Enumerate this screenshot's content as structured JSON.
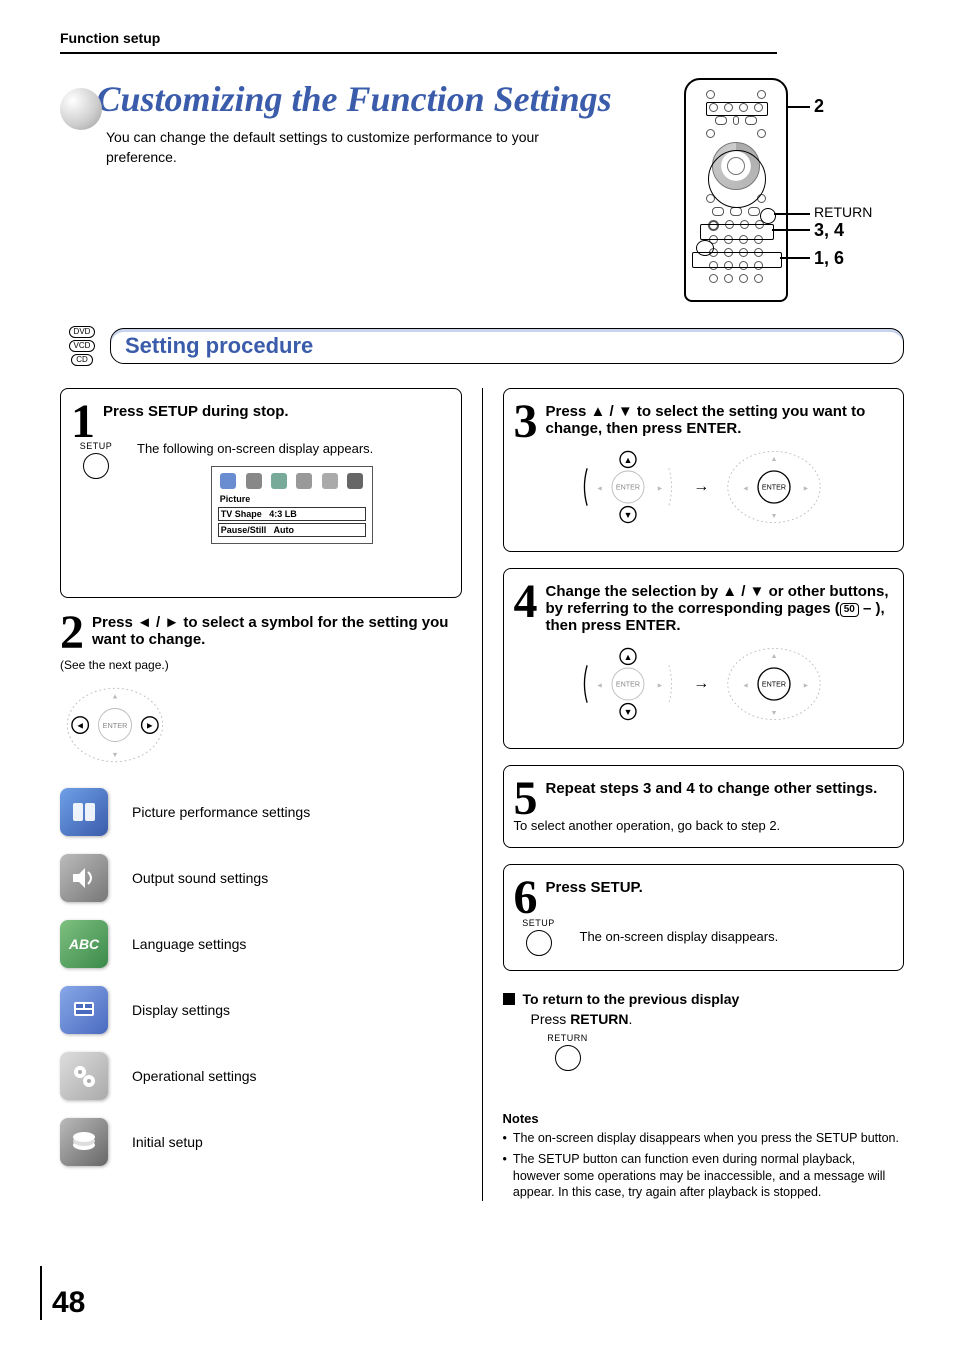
{
  "header": {
    "section": "Function setup"
  },
  "title": {
    "main": "Customizing the Function Settings",
    "sub": "You can change the default settings to customize performance to your preference."
  },
  "remote": {
    "callouts": [
      {
        "label": "2"
      },
      {
        "label": "RETURN"
      },
      {
        "label": "3, 4"
      },
      {
        "label": "1, 6"
      }
    ]
  },
  "disc_tags": [
    "DVD",
    "VCD",
    "CD"
  ],
  "procedure_title": "Setting procedure",
  "steps": {
    "s1": {
      "num": "1",
      "head": "Press SETUP during stop.",
      "setup_label": "SETUP",
      "text": "The following on-screen display appears.",
      "osd": {
        "line1": "Picture",
        "line2_left": "TV Shape",
        "line2_right": "4:3 LB",
        "line3_left": "Pause/Still",
        "line3_right": "Auto"
      }
    },
    "s2": {
      "num": "2",
      "head": "Press ◄ / ► to select a symbol for the setting you want to change.",
      "note": "(See the next page.)",
      "enter": "ENTER",
      "categories": [
        {
          "label": "Picture performance settings",
          "icon": "picture"
        },
        {
          "label": "Output sound settings",
          "icon": "sound"
        },
        {
          "label": "Language settings",
          "icon": "lang"
        },
        {
          "label": "Display settings",
          "icon": "disp"
        },
        {
          "label": "Operational settings",
          "icon": "op"
        },
        {
          "label": "Initial setup",
          "icon": "init"
        }
      ]
    },
    "s3": {
      "num": "3",
      "head": "Press ▲ / ▼ to select the setting you want to change, then press ENTER.",
      "enter": "ENTER"
    },
    "s4": {
      "num": "4",
      "head_pre": "Change the selection by ▲ / ▼ or other buttons, by referring to the corresponding pages (",
      "page_ref": "50",
      "head_post": " – ), then press ENTER.",
      "enter": "ENTER"
    },
    "s5": {
      "num": "5",
      "head": "Repeat steps 3 and 4 to change other settings.",
      "text": "To select another operation, go back to step 2."
    },
    "s6": {
      "num": "6",
      "head": "Press SETUP.",
      "setup_label": "SETUP",
      "text": "The on-screen display disappears."
    }
  },
  "return_block": {
    "heading": "To return to the previous display",
    "text_pre": "Press ",
    "text_bold": "RETURN",
    "text_post": ".",
    "btn_label": "RETURN"
  },
  "notes": {
    "heading": "Notes",
    "items": [
      "The on-screen display disappears when you press the SETUP button.",
      "The SETUP button can function even during normal playback, however some operations may be inaccessible, and a message will appear. In this case, try again after playback is stopped."
    ]
  },
  "page_number": "48"
}
